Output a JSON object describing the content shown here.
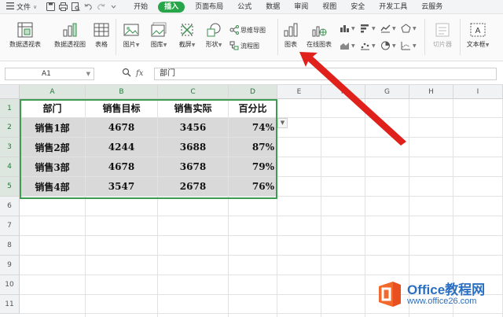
{
  "menu": {
    "file_label": "文件",
    "tabs": [
      {
        "label": "开始"
      },
      {
        "label": "插入",
        "active": true
      },
      {
        "label": "页面布局"
      },
      {
        "label": "公式"
      },
      {
        "label": "数据"
      },
      {
        "label": "审阅"
      },
      {
        "label": "视图"
      },
      {
        "label": "安全"
      },
      {
        "label": "开发工具"
      },
      {
        "label": "云服务"
      }
    ],
    "quick_access_icons": [
      "menu-icon",
      "save-icon",
      "print-icon",
      "print-preview-icon",
      "undo-icon",
      "redo-icon",
      "more-icon"
    ]
  },
  "ribbon": {
    "pivot_table": "数据透视表",
    "pivot_chart": "数据透视图",
    "table": "表格",
    "picture": "图片",
    "gallery": "图库",
    "screenshot": "截屏",
    "shapes": "形状",
    "mindmap": "思维导图",
    "flowchart": "流程图",
    "chart": "图表",
    "online_chart": "在线图表",
    "slicer": "切片器",
    "textbox": "文本框"
  },
  "formula_bar": {
    "name_box": "A1",
    "fx_label": "fx",
    "formula": "部门"
  },
  "columns": [
    "A",
    "B",
    "C",
    "D",
    "E",
    "F",
    "G",
    "H",
    "I"
  ],
  "rows": [
    "1",
    "2",
    "3",
    "4",
    "5",
    "6",
    "7",
    "8",
    "9",
    "10",
    "11"
  ],
  "table": {
    "headers": [
      "部门",
      "销售目标",
      "销售实际",
      "百分比"
    ],
    "rows": [
      [
        "销售1部",
        "4678",
        "3456",
        "74%"
      ],
      [
        "销售2部",
        "4244",
        "3688",
        "87%"
      ],
      [
        "销售3部",
        "4678",
        "3678",
        "79%"
      ],
      [
        "销售4部",
        "3547",
        "2678",
        "76%"
      ]
    ]
  },
  "watermark": {
    "brand": "Office教程网",
    "url": "www.office26.com"
  },
  "colors": {
    "accent_green": "#27a649",
    "selection_border": "#3c9d50",
    "selected_fill": "#d9d9d9",
    "arrow_red": "#e0201b"
  }
}
